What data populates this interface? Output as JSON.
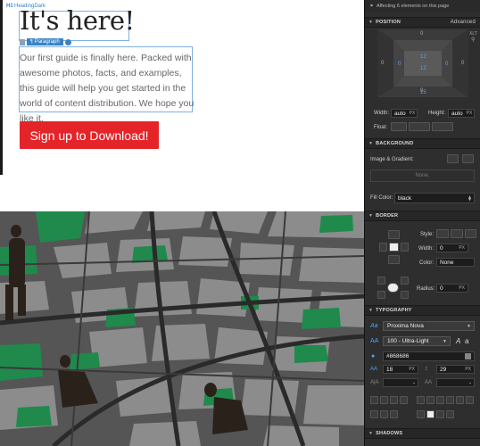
{
  "canvas": {
    "heading_tag": "H1",
    "heading_class": "HeadingDark",
    "heading_text": "It's here!",
    "paragraph_tag": "Paragraph",
    "paragraph_text": "Our first guide is finally here. Packed with awesome photos, facts, and examples, this guide will help you get started in the world of content distribution. We hope you like it.",
    "cta_label": "Sign up to Download!"
  },
  "panel": {
    "affecting_text": "Affecting 6 elements on this page",
    "position": {
      "title": "POSITION",
      "mode": "Advanced",
      "margin_top": "0",
      "margin_left": "0",
      "margin_right": "0",
      "margin_bottom": "0",
      "padding_top": "12",
      "padding_left": "0",
      "padding_right": "0",
      "padding_bottom": "12",
      "outer_bottom": "15",
      "xlt": "XLT",
      "width_label": "Width:",
      "width_value": "auto",
      "width_unit": "PX",
      "height_label": "Height:",
      "height_value": "auto",
      "height_unit": "PX",
      "float_label": "Float:"
    },
    "background": {
      "title": "BACKGROUND",
      "image_label": "Image & Gradient:",
      "none_text": "None.",
      "fill_label": "Fill Color:",
      "fill_value": "black"
    },
    "border": {
      "title": "BORDER",
      "style_label": "Style:",
      "width_label": "Width:",
      "width_value": "0",
      "width_unit": "PX",
      "color_label": "Color:",
      "color_value": "None",
      "radius_label": "Radius:",
      "radius_value": "0",
      "radius_unit": "PX"
    },
    "typography": {
      "title": "TYPOGRAPHY",
      "font": "Proxima Nova",
      "weight": "100 - Ultra-Light",
      "color": "#868686",
      "size": "18",
      "size_unit": "PX",
      "line_height": "29",
      "line_height_unit": "PX",
      "dash1": "-",
      "dash2": "-"
    },
    "shadows": {
      "title": "SHADOWS"
    }
  },
  "colors": {
    "cta": "#e52429",
    "selection": "#3b82c4",
    "panel_bg": "#2e2e2e"
  }
}
